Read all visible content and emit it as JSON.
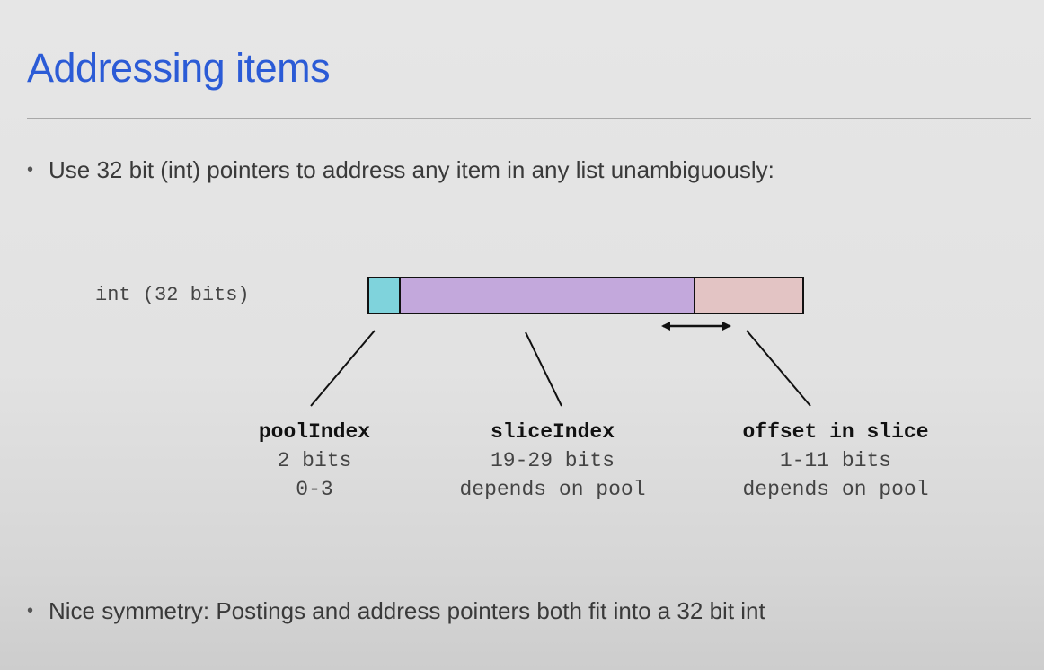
{
  "slide": {
    "title": "Addressing items",
    "bullets": [
      "Use 32 bit (int) pointers to address any item in any list unambiguously:",
      "Nice symmetry: Postings and address pointers both fit into a 32 bit int"
    ]
  },
  "diagram": {
    "int_label": "int (32 bits)",
    "segment_colors": {
      "pool": "#7fd3dc",
      "slice": "#c3a8dc",
      "offset": "#e3c4c4"
    },
    "fields": [
      {
        "name": "poolIndex",
        "line1": "2 bits",
        "line2": "0-3"
      },
      {
        "name": "sliceIndex",
        "line1": "19-29 bits",
        "line2": "depends on pool"
      },
      {
        "name": "offset in slice",
        "line1": "1-11 bits",
        "line2": "depends on pool"
      }
    ]
  }
}
